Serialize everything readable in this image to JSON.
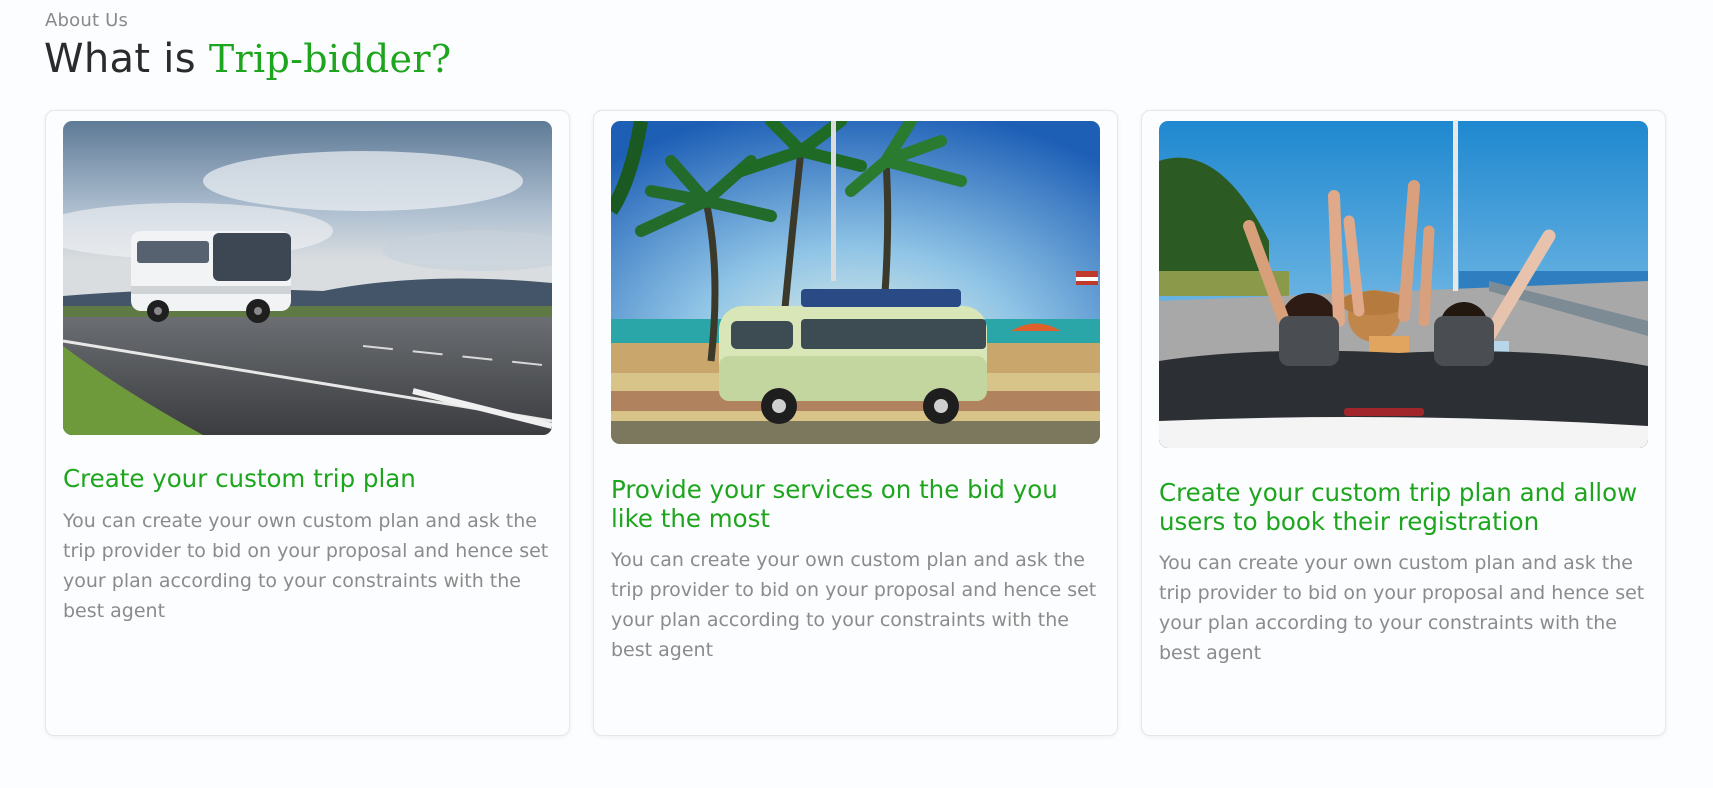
{
  "section": {
    "eyebrow": "About Us",
    "heading_prefix": "What is ",
    "heading_highlight": "Trip-bidder?"
  },
  "colors": {
    "accent": "#1ea51e",
    "body_text": "#8b8b8b",
    "heading_text": "#2b2b2b"
  },
  "cards": [
    {
      "image": "bus-on-highway-photo",
      "title": "Create your custom trip plan",
      "text": "You can create your own custom plan and ask the trip provider to bid on your proposal and hence set your plan according to your constraints with the best agent"
    },
    {
      "image": "camper-van-beach-photo",
      "title": "Provide your services on the bid you like the most",
      "text": "You can create your own custom plan and ask the trip provider to bid on your proposal and hence set your plan according to your constraints with the best agent"
    },
    {
      "image": "friends-convertible-road-trip-photo",
      "title": "Create your custom trip plan and allow users to book their registration",
      "text": "You can create your own custom plan and ask the trip provider to bid on your proposal and hence set your plan according to your constraints with the best agent"
    }
  ]
}
